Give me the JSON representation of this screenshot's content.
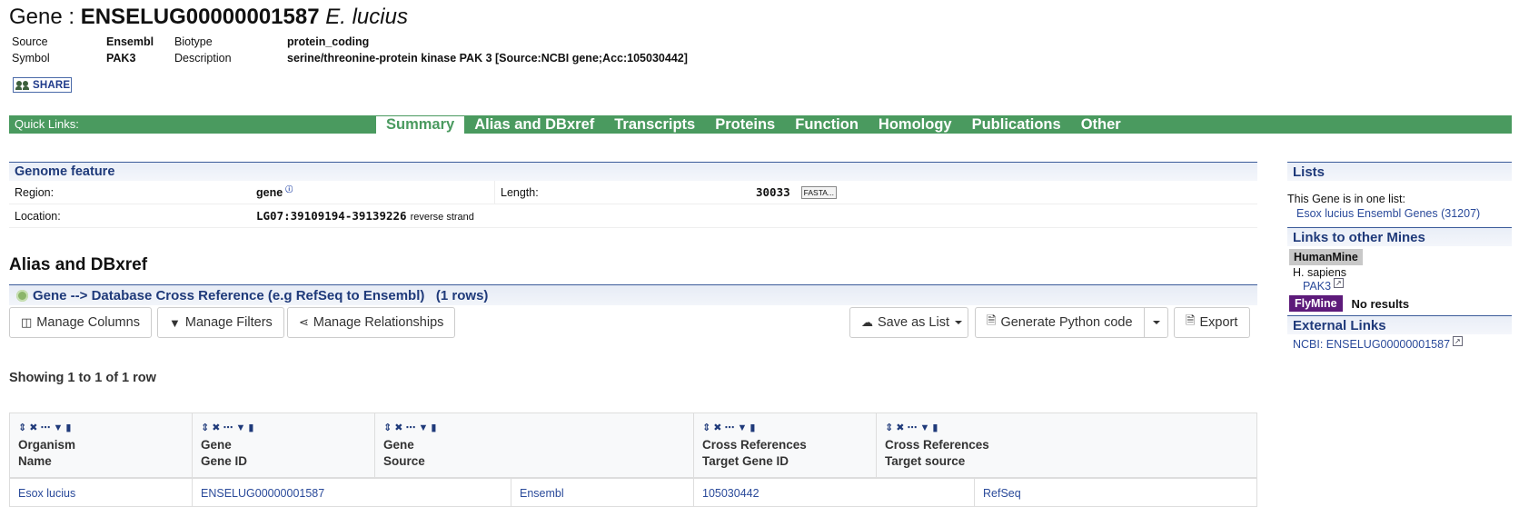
{
  "header": {
    "prefix": "Gene :",
    "gene_id": "ENSELUG00000001587",
    "species": "E. lucius",
    "meta": {
      "source_label": "Source",
      "source_value": "Ensembl",
      "biotype_label": "Biotype",
      "biotype_value": "protein_coding",
      "symbol_label": "Symbol",
      "symbol_value": "PAK3",
      "description_label": "Description",
      "description_value": "serine/threonine-protein kinase PAK 3 [Source:NCBI gene;Acc:105030442]"
    },
    "share_label": "SHARE"
  },
  "quicklinks": {
    "label": "Quick Links:",
    "tabs": [
      "Summary",
      "Alias and DBxref",
      "Transcripts",
      "Proteins",
      "Function",
      "Homology",
      "Publications",
      "Other"
    ],
    "active": "Summary"
  },
  "genome_feature": {
    "title": "Genome feature",
    "region_label": "Region:",
    "region_value": "gene",
    "length_label": "Length:",
    "length_value": "30033",
    "fasta_label": "FASTA...",
    "location_label": "Location:",
    "location_value": "LG07:39109194-39139226",
    "strand": "reverse strand"
  },
  "alias": {
    "title": "Alias and DBxref",
    "table_title": "Gene --> Database Cross Reference (e.g RefSeq to Ensembl)",
    "rows_count": "(1 rows)",
    "buttons": {
      "manage_columns": "Manage Columns",
      "manage_filters": "Manage Filters",
      "manage_relationships": "Manage Relationships",
      "save_as_list": "Save as List",
      "generate_python": "Generate Python code",
      "export": "Export"
    },
    "showing": "Showing 1 to 1 of 1 row",
    "columns": [
      {
        "line1": "Organism",
        "line2": "Name"
      },
      {
        "line1": "Gene",
        "line2": "Gene ID"
      },
      {
        "line1": "Gene",
        "line2": "Source"
      },
      {
        "line1": "Cross References",
        "line2": "Target Gene ID"
      },
      {
        "line1": "Cross References",
        "line2": "Target source"
      }
    ],
    "rows": [
      [
        "Esox lucius",
        "ENSELUG00000001587",
        "Ensembl",
        "105030442",
        "RefSeq"
      ]
    ]
  },
  "sidebar": {
    "lists_title": "Lists",
    "lists_text": "This Gene is in one list:",
    "list_link": "Esox lucius Ensembl Genes (31207)",
    "mines_title": "Links to other Mines",
    "humanmine": "HumanMine",
    "humanmine_species": "H. sapiens",
    "humanmine_link": "PAK3",
    "flymine": "FlyMine",
    "flymine_result": "No results",
    "external_title": "External Links",
    "external_link": "NCBI: ENSELUG00000001587"
  },
  "colors": {
    "quicklinks_bar": "#4a9a5f",
    "section_header_text": "#1f3a7a",
    "link": "#2a4a9a",
    "flymine_badge": "#5d1a7a"
  }
}
